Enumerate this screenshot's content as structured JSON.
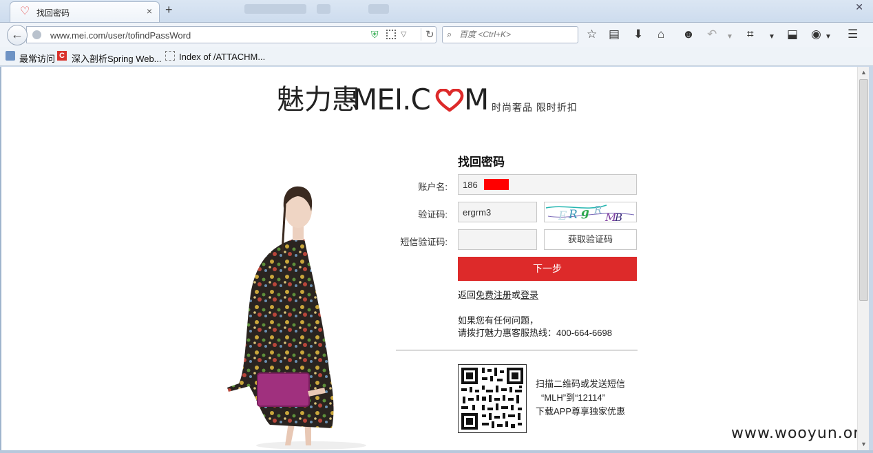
{
  "browser": {
    "tab_title": "找回密码",
    "tab_close": "×",
    "new_tab": "+",
    "url": "www.mei.com/user/tofindPassWord",
    "search_placeholder": "百度 <Ctrl+K>",
    "bookmarks": [
      "最常访问",
      "深入剖析Spring Web...",
      "Index of /ATTACHM..."
    ]
  },
  "page": {
    "logo_cn": "魅力惠",
    "logo_en": "MEI.C",
    "logo_en_end": "M",
    "slogan": "时尚奢品  限时折扣",
    "accent_color": "#dd2a2a"
  },
  "form": {
    "title": "找回密码",
    "account_label": "账户名:",
    "account_value": "186        98",
    "captcha_label": "验证码:",
    "captcha_value": "ergrm3",
    "captcha_image_text": "ERgRMB",
    "sms_label": "短信验证码:",
    "sms_value": "",
    "sms_button": "获取验证码",
    "next_button": "下一步",
    "return_prefix": "返回",
    "register_link": "免费注册",
    "return_or": "或",
    "login_link": "登录",
    "help_line1": "如果您有任何问题，",
    "help_line2": "请拨打魅力惠客服热线：400-664-6698"
  },
  "qr": {
    "line1": "扫描二维码或发送短信",
    "line2": "“MLH”到“12114”",
    "line3": "下载APP尊享独家优惠"
  },
  "watermark": "www.wooyun.org"
}
